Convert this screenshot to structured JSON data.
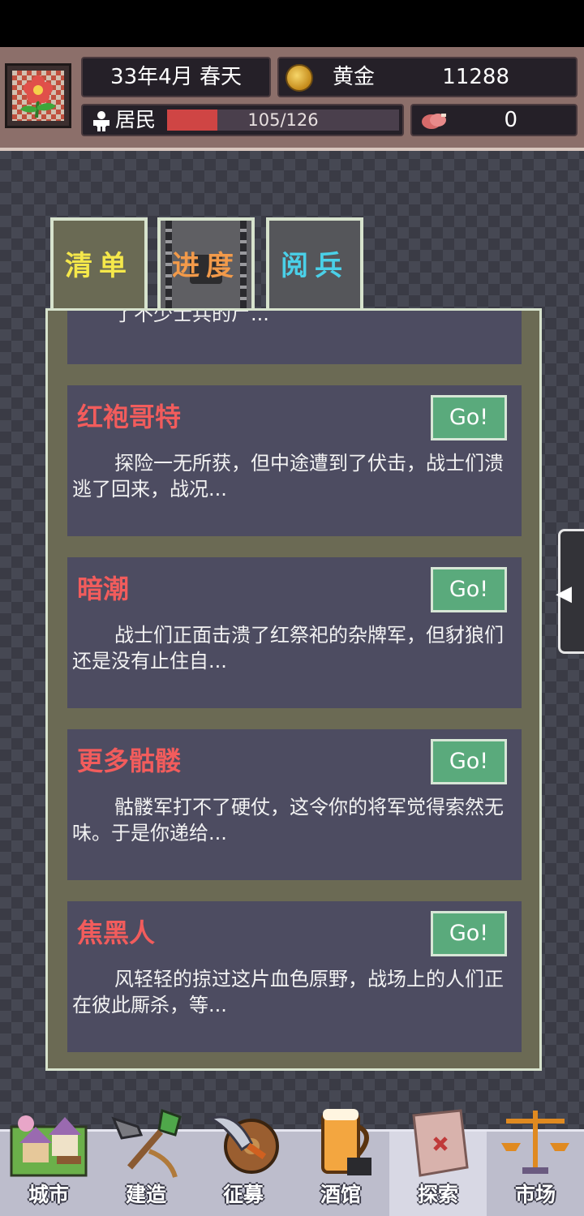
{
  "header": {
    "date": "33年4月 春天",
    "gold_label": "黄金",
    "gold_value": "11288",
    "residents_label": "居民",
    "residents_text": "105/126",
    "residents_fraction": 0.833,
    "meat_value": "0"
  },
  "tabs": [
    {
      "label": "清单"
    },
    {
      "label": "进度"
    },
    {
      "label": "阅兵"
    }
  ],
  "quests": [
    {
      "title": "",
      "desc": "了不少士兵的尸...",
      "go": ""
    },
    {
      "title": "红袍哥特",
      "desc": "探险一无所获，但中途遭到了伏击，战士们溃逃了回来，战况...",
      "go": "Go!"
    },
    {
      "title": "暗潮",
      "desc": "战士们正面击溃了红祭祀的杂牌军，但豺狼们还是没有止住自...",
      "go": "Go!"
    },
    {
      "title": "更多骷髅",
      "desc": "骷髅军打不了硬仗，这令你的将军觉得索然无味。于是你递给...",
      "go": "Go!"
    },
    {
      "title": "焦黑人",
      "desc": "风轻轻的掠过这片血色原野，战场上的人们正在彼此厮杀，等...",
      "go": "Go!"
    }
  ],
  "nav": [
    {
      "label": "城市",
      "icon": "city-icon"
    },
    {
      "label": "建造",
      "icon": "shovel-icon"
    },
    {
      "label": "征募",
      "icon": "weapon-shield-icon"
    },
    {
      "label": "酒馆",
      "icon": "beer-icon"
    },
    {
      "label": "探索",
      "icon": "map-icon",
      "active": true
    },
    {
      "label": "市场",
      "icon": "scale-icon"
    }
  ]
}
